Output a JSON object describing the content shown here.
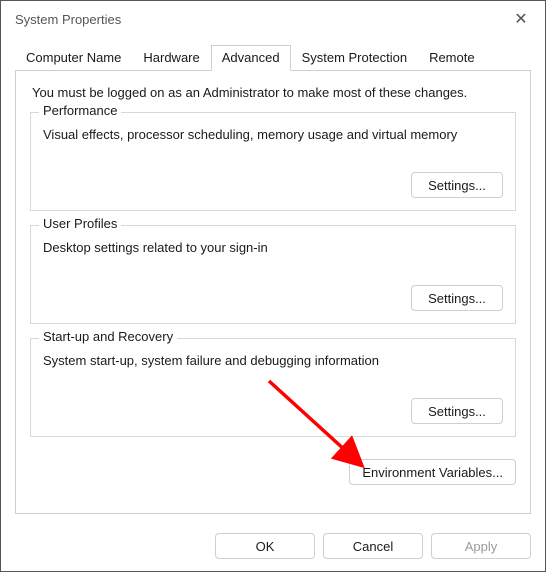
{
  "window": {
    "title": "System Properties"
  },
  "tabs": {
    "computer_name": "Computer Name",
    "hardware": "Hardware",
    "advanced": "Advanced",
    "system_protection": "System Protection",
    "remote": "Remote"
  },
  "advanced": {
    "intro": "You must be logged on as an Administrator to make most of these changes.",
    "performance": {
      "legend": "Performance",
      "desc": "Visual effects, processor scheduling, memory usage and virtual memory",
      "button": "Settings..."
    },
    "user_profiles": {
      "legend": "User Profiles",
      "desc": "Desktop settings related to your sign-in",
      "button": "Settings..."
    },
    "startup_recovery": {
      "legend": "Start-up and Recovery",
      "desc": "System start-up, system failure and debugging information",
      "button": "Settings..."
    },
    "env_vars_button": "Environment Variables..."
  },
  "footer": {
    "ok": "OK",
    "cancel": "Cancel",
    "apply": "Apply"
  },
  "annotation": {
    "arrow_color": "#ff0000"
  }
}
